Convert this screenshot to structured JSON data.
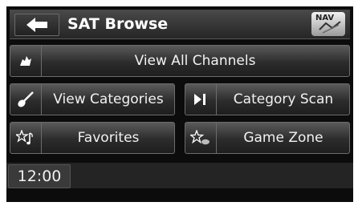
{
  "header": {
    "title": "SAT Browse",
    "nav_label": "NAV"
  },
  "buttons": {
    "view_all_channels": "View All Channels",
    "view_categories": "View Categories",
    "category_scan": "Category Scan",
    "favorites": "Favorites",
    "game_zone": "Game Zone"
  },
  "status": {
    "clock": "12:00"
  },
  "icons": {
    "back": "left-arrow-icon",
    "nav": "map-icon",
    "view_all": "satellite-dog-icon",
    "categories": "guitar-icon",
    "scan": "skip-next-icon",
    "favorites": "star-note-icon",
    "game_zone": "star-ball-icon"
  }
}
